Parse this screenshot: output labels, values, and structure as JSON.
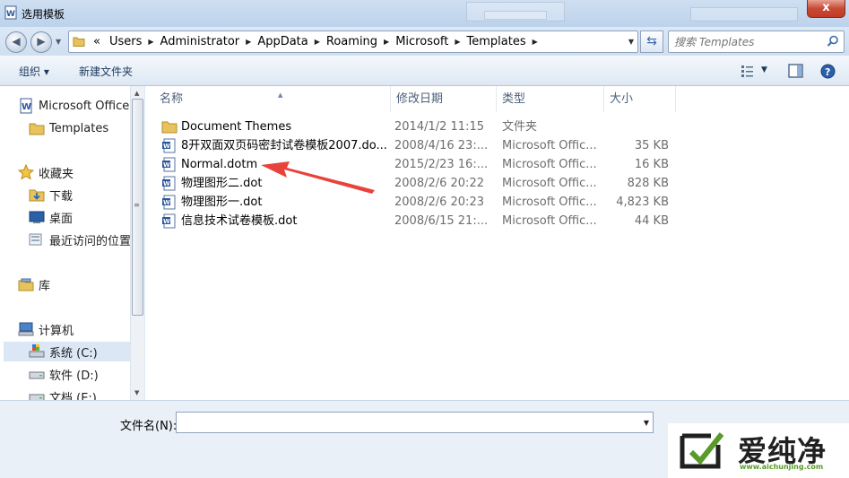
{
  "window": {
    "title": "选用模板",
    "close_label": "x"
  },
  "address": {
    "crumbs": [
      "Users",
      "Administrator",
      "AppData",
      "Roaming",
      "Microsoft",
      "Templates"
    ],
    "prefix": "«"
  },
  "search": {
    "placeholder": "搜索 Templates"
  },
  "toolbar": {
    "organize_label": "组织 ▾",
    "new_folder_label": "新建文件夹"
  },
  "nav": {
    "items": [
      {
        "label": "Microsoft Office",
        "icon": "word-icon"
      },
      {
        "label": "Templates",
        "icon": "folder-icon"
      },
      {
        "label": "收藏夹",
        "icon": "star-icon"
      },
      {
        "label": "下载",
        "icon": "download-folder-icon"
      },
      {
        "label": "桌面",
        "icon": "desktop-icon"
      },
      {
        "label": "最近访问的位置",
        "icon": "recent-icon"
      },
      {
        "label": "库",
        "icon": "library-icon"
      },
      {
        "label": "计算机",
        "icon": "computer-icon"
      },
      {
        "label": "系统 (C:)",
        "icon": "drive-icon"
      },
      {
        "label": "软件 (D:)",
        "icon": "drive-icon"
      },
      {
        "label": "文档 (E:)",
        "icon": "drive-icon"
      }
    ]
  },
  "columns": {
    "name": "名称",
    "date": "修改日期",
    "type": "类型",
    "size": "大小"
  },
  "files": [
    {
      "name": "Document Themes",
      "date": "2014/1/2 11:15",
      "type": "文件夹",
      "size": "",
      "icon": "folder-icon"
    },
    {
      "name": "8开双面双页码密封试卷模板2007.do...",
      "date": "2008/4/16 23:...",
      "type": "Microsoft Offic...",
      "size": "35 KB",
      "icon": "word-doc-icon"
    },
    {
      "name": "Normal.dotm",
      "date": "2015/2/23 16:...",
      "type": "Microsoft Offic...",
      "size": "16 KB",
      "icon": "word-doc-icon"
    },
    {
      "name": "物理图形二.dot",
      "date": "2008/2/6 20:22",
      "type": "Microsoft Offic...",
      "size": "828 KB",
      "icon": "word-doc-icon"
    },
    {
      "name": "物理图形一.dot",
      "date": "2008/2/6 20:23",
      "type": "Microsoft Offic...",
      "size": "4,823 KB",
      "icon": "word-doc-icon"
    },
    {
      "name": "信息技术试卷模板.dot",
      "date": "2008/6/15 21:...",
      "type": "Microsoft Offic...",
      "size": "44 KB",
      "icon": "word-doc-icon"
    }
  ],
  "bottom": {
    "filename_label": "文件名(N):",
    "filename_value": ""
  },
  "watermark": {
    "brand": "爱纯净",
    "url": "www.aichunjing.com"
  },
  "colors": {
    "arrow": "#e8433a",
    "folder": "#e8c25a",
    "accent": "#3b6aa8",
    "watermark_green": "#5a9a2a"
  }
}
